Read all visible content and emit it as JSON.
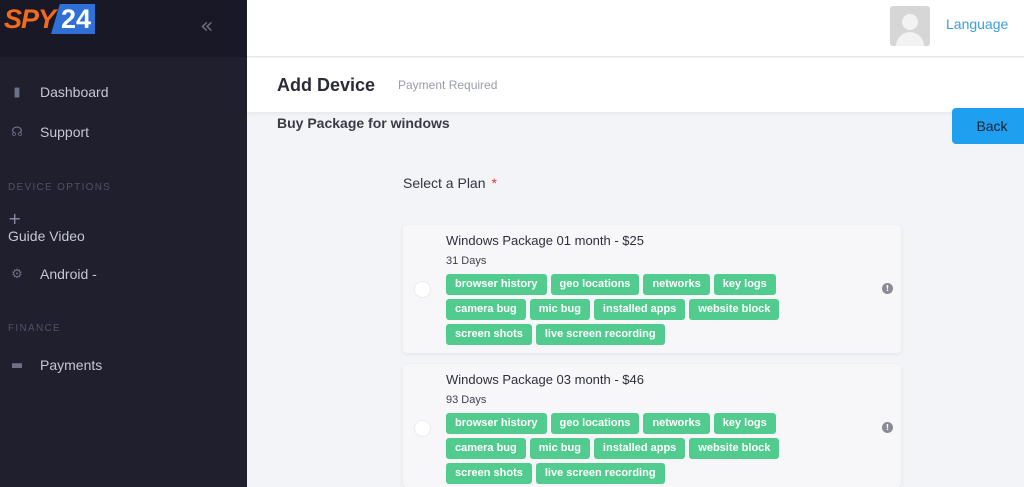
{
  "brand": {
    "logo_a": "SPY",
    "logo_b": "24"
  },
  "sidebar": {
    "collapse_icon": "«",
    "items": [
      {
        "label": "Dashboard",
        "icon": "dashboard-icon",
        "glyph": "▮"
      },
      {
        "label": "Support",
        "icon": "headset-icon",
        "glyph": "☊"
      },
      {
        "label": "Android -",
        "icon": "settings-icon",
        "glyph": "⚙"
      },
      {
        "label": "Payments",
        "icon": "card-icon",
        "glyph": "▬"
      }
    ],
    "section_device": "DEVICE OPTIONS",
    "section_finance": "FINANCE",
    "add_glyph": "+",
    "guide_video": "Guide Video"
  },
  "header": {
    "language": "Language",
    "title": "Add Device",
    "subtitle": "Payment Required"
  },
  "main": {
    "buy_title": "Buy Package for windows",
    "back_label": "Back",
    "select_label": "Select a Plan",
    "required_mark": "*",
    "info_glyph": "!",
    "plans": [
      {
        "name": "Windows Package 01 month - $25",
        "days": "31 Days",
        "features": [
          [
            "browser history",
            "geo locations",
            "networks",
            "key logs"
          ],
          [
            "camera bug",
            "mic bug",
            "installed apps",
            "website block"
          ],
          [
            "screen shots",
            "live screen recording"
          ]
        ]
      },
      {
        "name": "Windows Package 03 month - $46",
        "days": "93 Days",
        "features": [
          [
            "browser history",
            "geo locations",
            "networks",
            "key logs"
          ],
          [
            "camera bug",
            "mic bug",
            "installed apps",
            "website block"
          ],
          [
            "screen shots",
            "live screen recording"
          ]
        ]
      }
    ]
  },
  "colors": {
    "sidebar_bg": "#1f1f2e",
    "accent_blue": "#1e9ff0",
    "tag_green": "#52cc8e",
    "logo_orange": "#f26b1d"
  }
}
